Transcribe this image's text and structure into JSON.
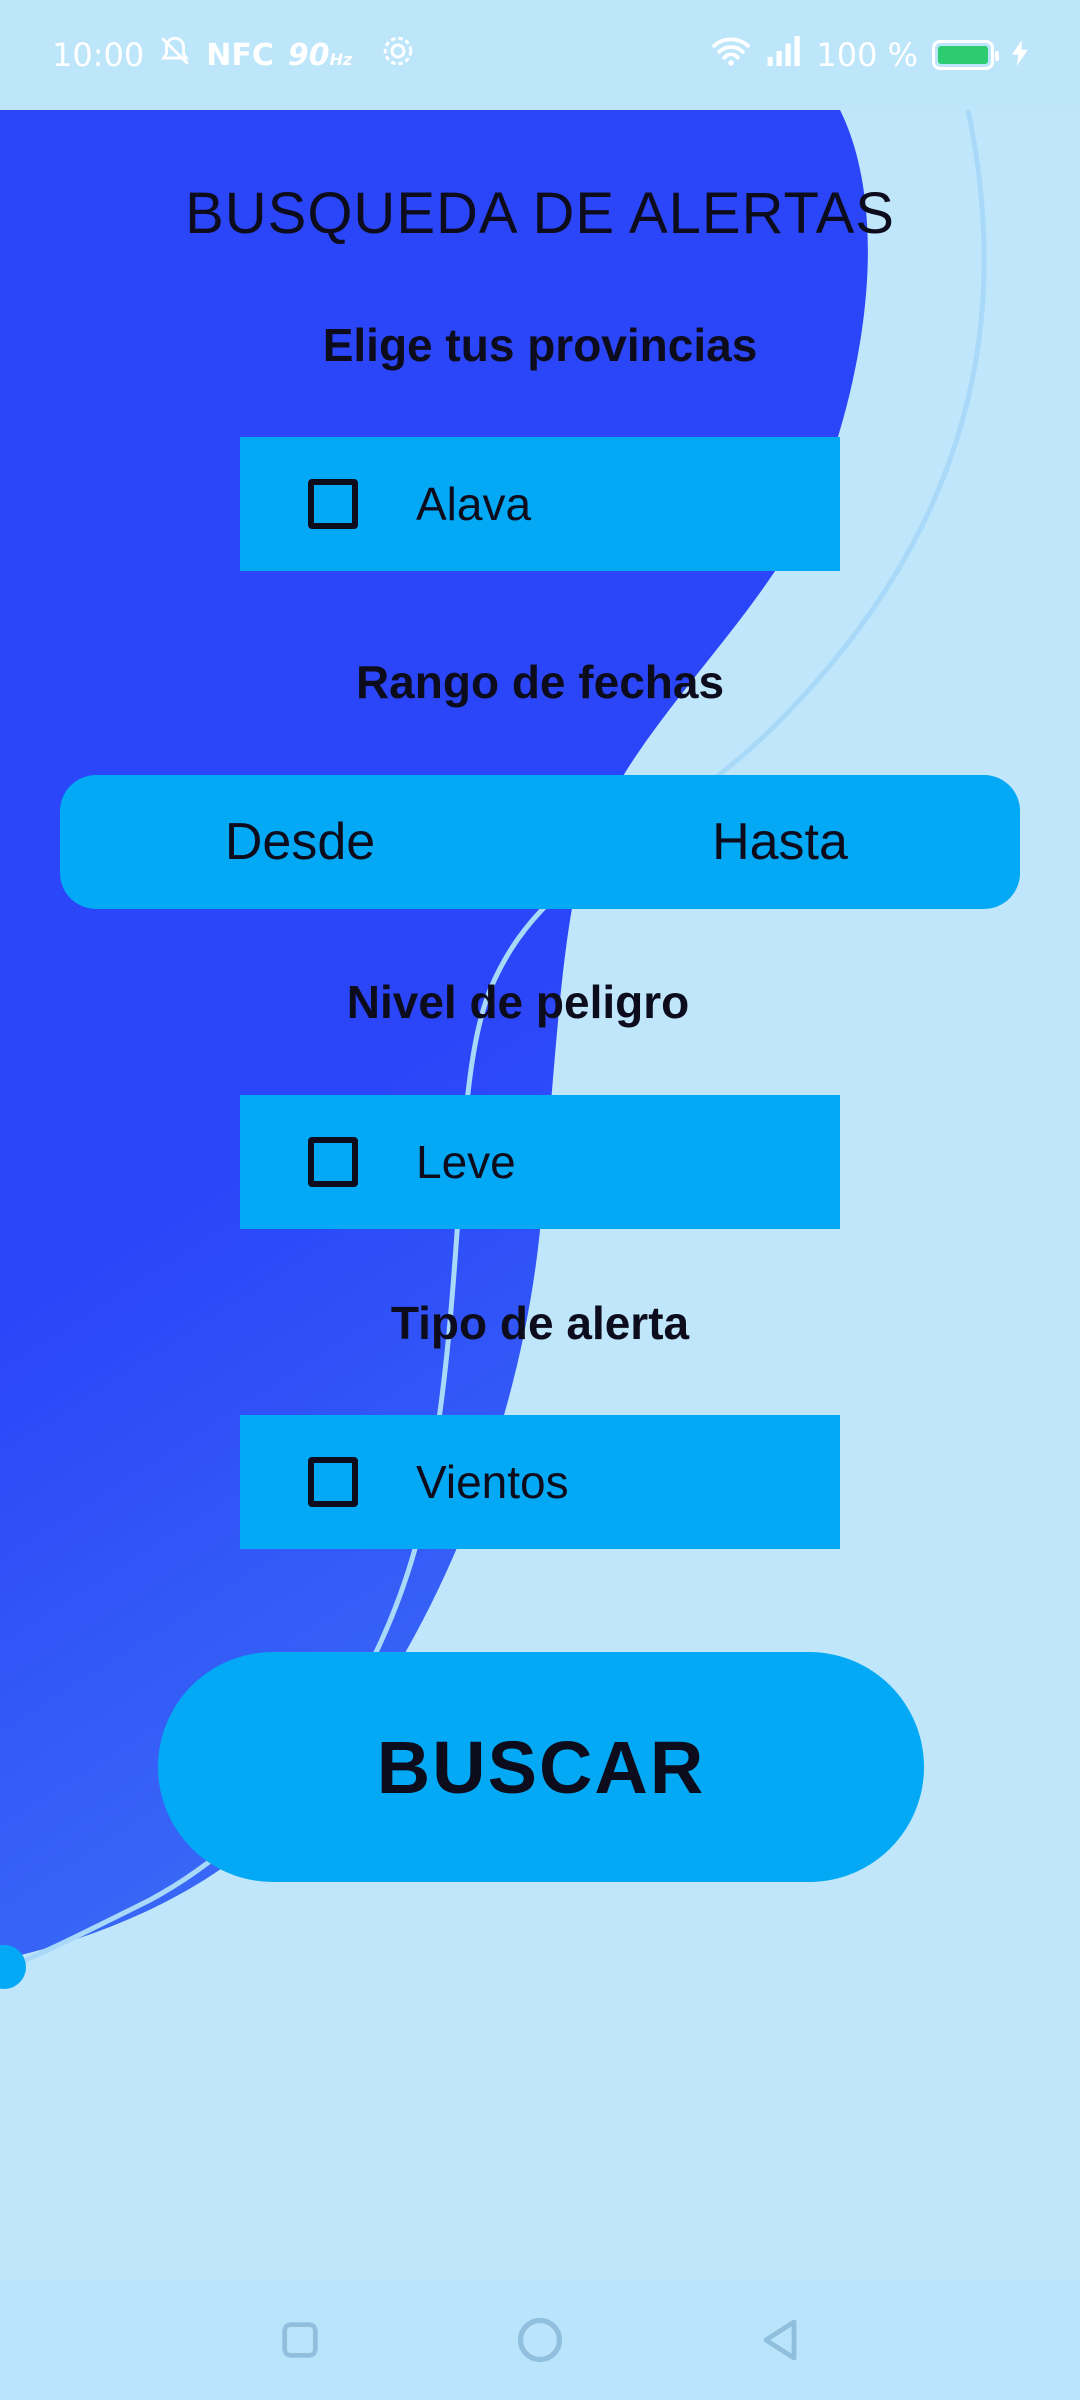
{
  "status_bar": {
    "time": "10:00",
    "nfc": "NFC",
    "refresh_rate": "90",
    "refresh_unit": "Hz",
    "battery": "100 %",
    "icons": [
      "alarm-off-icon",
      "settings-icon",
      "wifi-icon",
      "signal-icon",
      "battery-icon",
      "charging-icon"
    ]
  },
  "page": {
    "title": "BUSQUEDA DE ALERTAS"
  },
  "provinces": {
    "label": "Elige tus provincias",
    "option": "Alava",
    "checked": false
  },
  "dates": {
    "label": "Rango de fechas",
    "from": "Desde",
    "to": "Hasta"
  },
  "danger": {
    "label": "Nivel de peligro",
    "option": "Leve",
    "checked": false
  },
  "alert_type": {
    "label": "Tipo de alerta",
    "option": "Vientos",
    "checked": false
  },
  "search": {
    "label": "BUSCAR"
  },
  "nav_bar": {
    "icons": [
      "recent-apps-icon",
      "home-icon",
      "back-icon"
    ]
  },
  "colors": {
    "background": "#bfe6fb",
    "blue_shape": "#2a48f5",
    "accent": "#03a9f4",
    "text": "#0c0c1c"
  }
}
